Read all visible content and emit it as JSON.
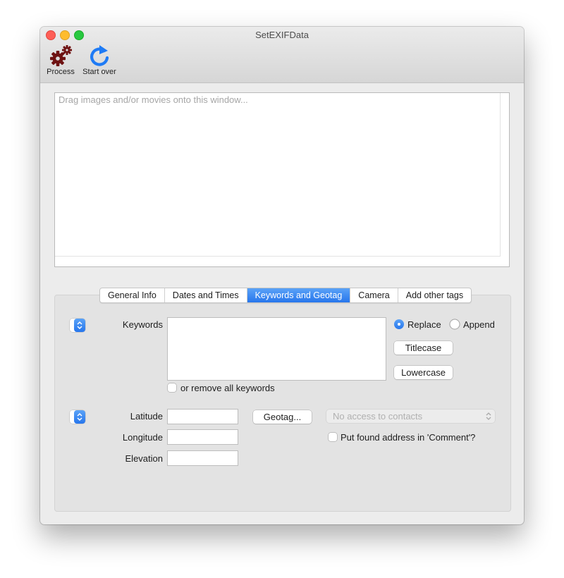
{
  "window": {
    "title": "SetEXIFData"
  },
  "toolbar": {
    "process_label": "Process",
    "start_over_label": "Start over",
    "process_icon": "gears-icon",
    "start_over_icon": "refresh-icon",
    "process_icon_color": "#6e1212",
    "start_over_icon_color": "#1f7bf5"
  },
  "dropzone": {
    "placeholder": "Drag images and/or movies onto this window..."
  },
  "tabs": [
    "General Info",
    "Dates and Times",
    "Keywords and Geotag",
    "Camera",
    "Add other tags"
  ],
  "active_tab": "Keywords and Geotag",
  "keywords": {
    "label": "Keywords",
    "value": "",
    "replace_label": "Replace",
    "append_label": "Append",
    "selected_mode": "Replace",
    "titlecase_label": "Titlecase",
    "lowercase_label": "Lowercase",
    "remove_all_label": "or remove all keywords",
    "remove_all_checked": false
  },
  "geotag": {
    "latitude_label": "Latitude",
    "longitude_label": "Longitude",
    "elevation_label": "Elevation",
    "latitude_value": "",
    "longitude_value": "",
    "elevation_value": "",
    "geotag_button": "Geotag...",
    "contacts_popup": "No access to contacts",
    "put_address_label": "Put found address in 'Comment'?",
    "put_address_checked": false
  },
  "colors": {
    "accent": "#2776ec",
    "panel": "#e3e3e3",
    "window": "#ececec"
  }
}
